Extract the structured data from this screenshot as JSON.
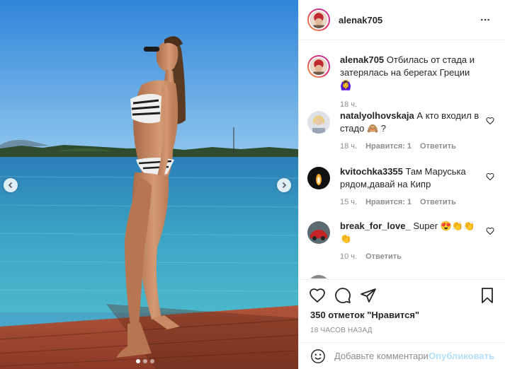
{
  "post": {
    "author": "alenak705",
    "more_icon": "more-horizontal-icon",
    "caption": {
      "username": "alenak705",
      "text": "Отбилась от стада и затерялась на берегах Греции 🙆‍♀️",
      "time": "18 ч."
    },
    "comments": [
      {
        "username": "natalyolhovskaja",
        "text": "А кто входил в стадо 🙈 ?",
        "time": "18 ч.",
        "likes": "Нравится: 1",
        "reply": "Ответить"
      },
      {
        "username": "kvitochka3355",
        "text": "Там Маруська рядом,давай на Кипр",
        "time": "15 ч.",
        "likes": "Нравится: 1",
        "reply": "Ответить"
      },
      {
        "username": "break_for_love_",
        "text": "Super 😍👏👏👏",
        "time": "10 ч.",
        "reply": "Ответить"
      },
      {
        "username": "",
        "text": ""
      }
    ],
    "likes_count": "350 отметок \"Нравится\"",
    "time_ago": "18 ЧАСОВ НАЗАД"
  },
  "actions": {
    "like_icon": "heart-icon",
    "comment_icon": "comment-icon",
    "share_icon": "share-icon",
    "save_icon": "bookmark-icon"
  },
  "add_comment": {
    "placeholder": "Добавьте комментарий...",
    "post_label": "Опубликовать"
  },
  "carousel": {
    "total": 3,
    "current": 1
  },
  "colors": {
    "link_disabled": "#b2dffc",
    "secondary_text": "#8e8e8e",
    "border": "#efefef"
  }
}
